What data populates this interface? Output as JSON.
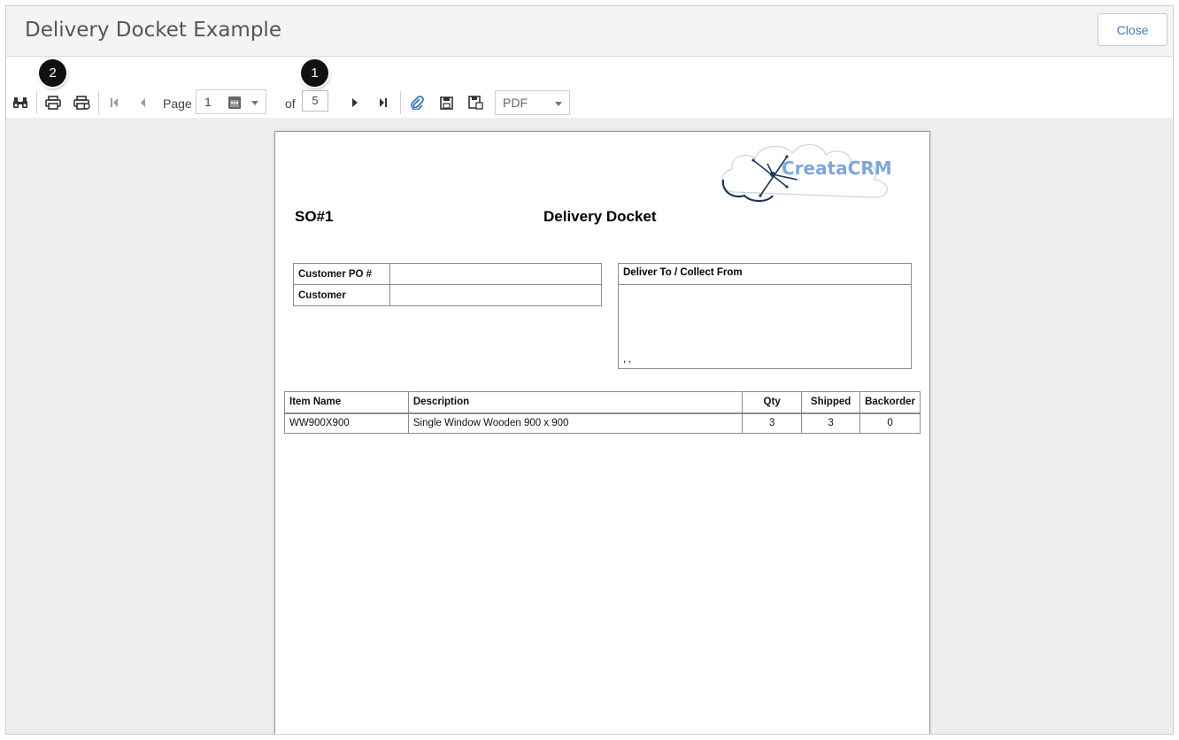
{
  "dialog": {
    "title": "Delivery Docket Example",
    "close_label": "Close"
  },
  "toolbar": {
    "page_label": "Page",
    "current_page": "1",
    "of_label": "of",
    "total_pages": "5",
    "export_format": "PDF",
    "icons": [
      "binoculars-icon",
      "print-icon",
      "print-preview-icon",
      "first-page-icon",
      "previous-page-icon",
      "calendar-icon",
      "next-page-icon",
      "last-page-icon",
      "attachment-icon",
      "save-icon",
      "save-as-icon"
    ]
  },
  "callouts": {
    "badge_1": "1",
    "badge_2": "2"
  },
  "document": {
    "so_number": "SO#1",
    "title": "Delivery Docket",
    "logo_text": "CreataCRM",
    "customer_table": [
      {
        "label": "Customer PO #",
        "value": ""
      },
      {
        "label": "Customer",
        "value": ""
      }
    ],
    "deliver_to": {
      "heading": "Deliver To / Collect From",
      "address": ", ,"
    },
    "items_headers": [
      "Item Name",
      "Description",
      "Qty",
      "Shipped",
      "Backorder"
    ],
    "items": [
      {
        "name": "WW900X900",
        "description": "Single Window Wooden 900 x 900",
        "qty": "3",
        "shipped": "3",
        "backorder": "0"
      }
    ]
  },
  "colors": {
    "accent": "#3d7fc1",
    "toolbar_icon": "#444444",
    "attachment_icon": "#2f6db3",
    "viewer_bg": "#eeeeee",
    "logo_blue": "#7fa8d8",
    "logo_dark": "#1c3656"
  }
}
